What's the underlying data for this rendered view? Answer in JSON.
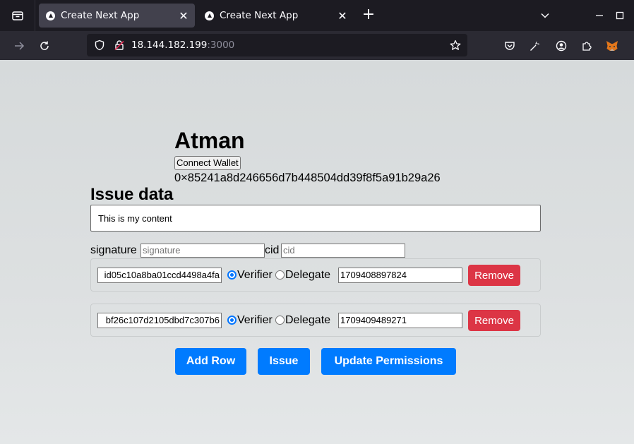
{
  "browser": {
    "tabs": [
      {
        "title": "Create Next App",
        "active": true
      },
      {
        "title": "Create Next App",
        "active": false
      }
    ],
    "new_tab_label": "+",
    "url": {
      "host": "18.144.182.199",
      "port": ":3000"
    }
  },
  "app": {
    "title": "Atman",
    "connect_button": "Connect Wallet",
    "address": "0×85241a8d246656d7b448504dd39f8f5a91b29a26",
    "issue_heading": "Issue data",
    "content": "This is my content",
    "signature_label": "signature",
    "signature_placeholder": "signature",
    "cid_label": "cid",
    "cid_placeholder": "cid",
    "rows": [
      {
        "address": "id05c10a8ba01ccd4498a4fa",
        "role": "Verifier",
        "verifier_label": "Verifier",
        "delegate_label": "Delegate",
        "timestamp": "1709408897824",
        "remove_label": "Remove"
      },
      {
        "address": "bf26c107d2105dbd7c307b6",
        "role": "Verifier",
        "verifier_label": "Verifier",
        "delegate_label": "Delegate",
        "timestamp": "1709409489271",
        "remove_label": "Remove"
      }
    ],
    "add_row_button": "Add Row",
    "issue_button": "Issue",
    "update_permissions_button": "Update Permissions"
  },
  "colors": {
    "primary": "#007bff",
    "danger": "#dc3545",
    "radio_checked": "#0075ff"
  }
}
